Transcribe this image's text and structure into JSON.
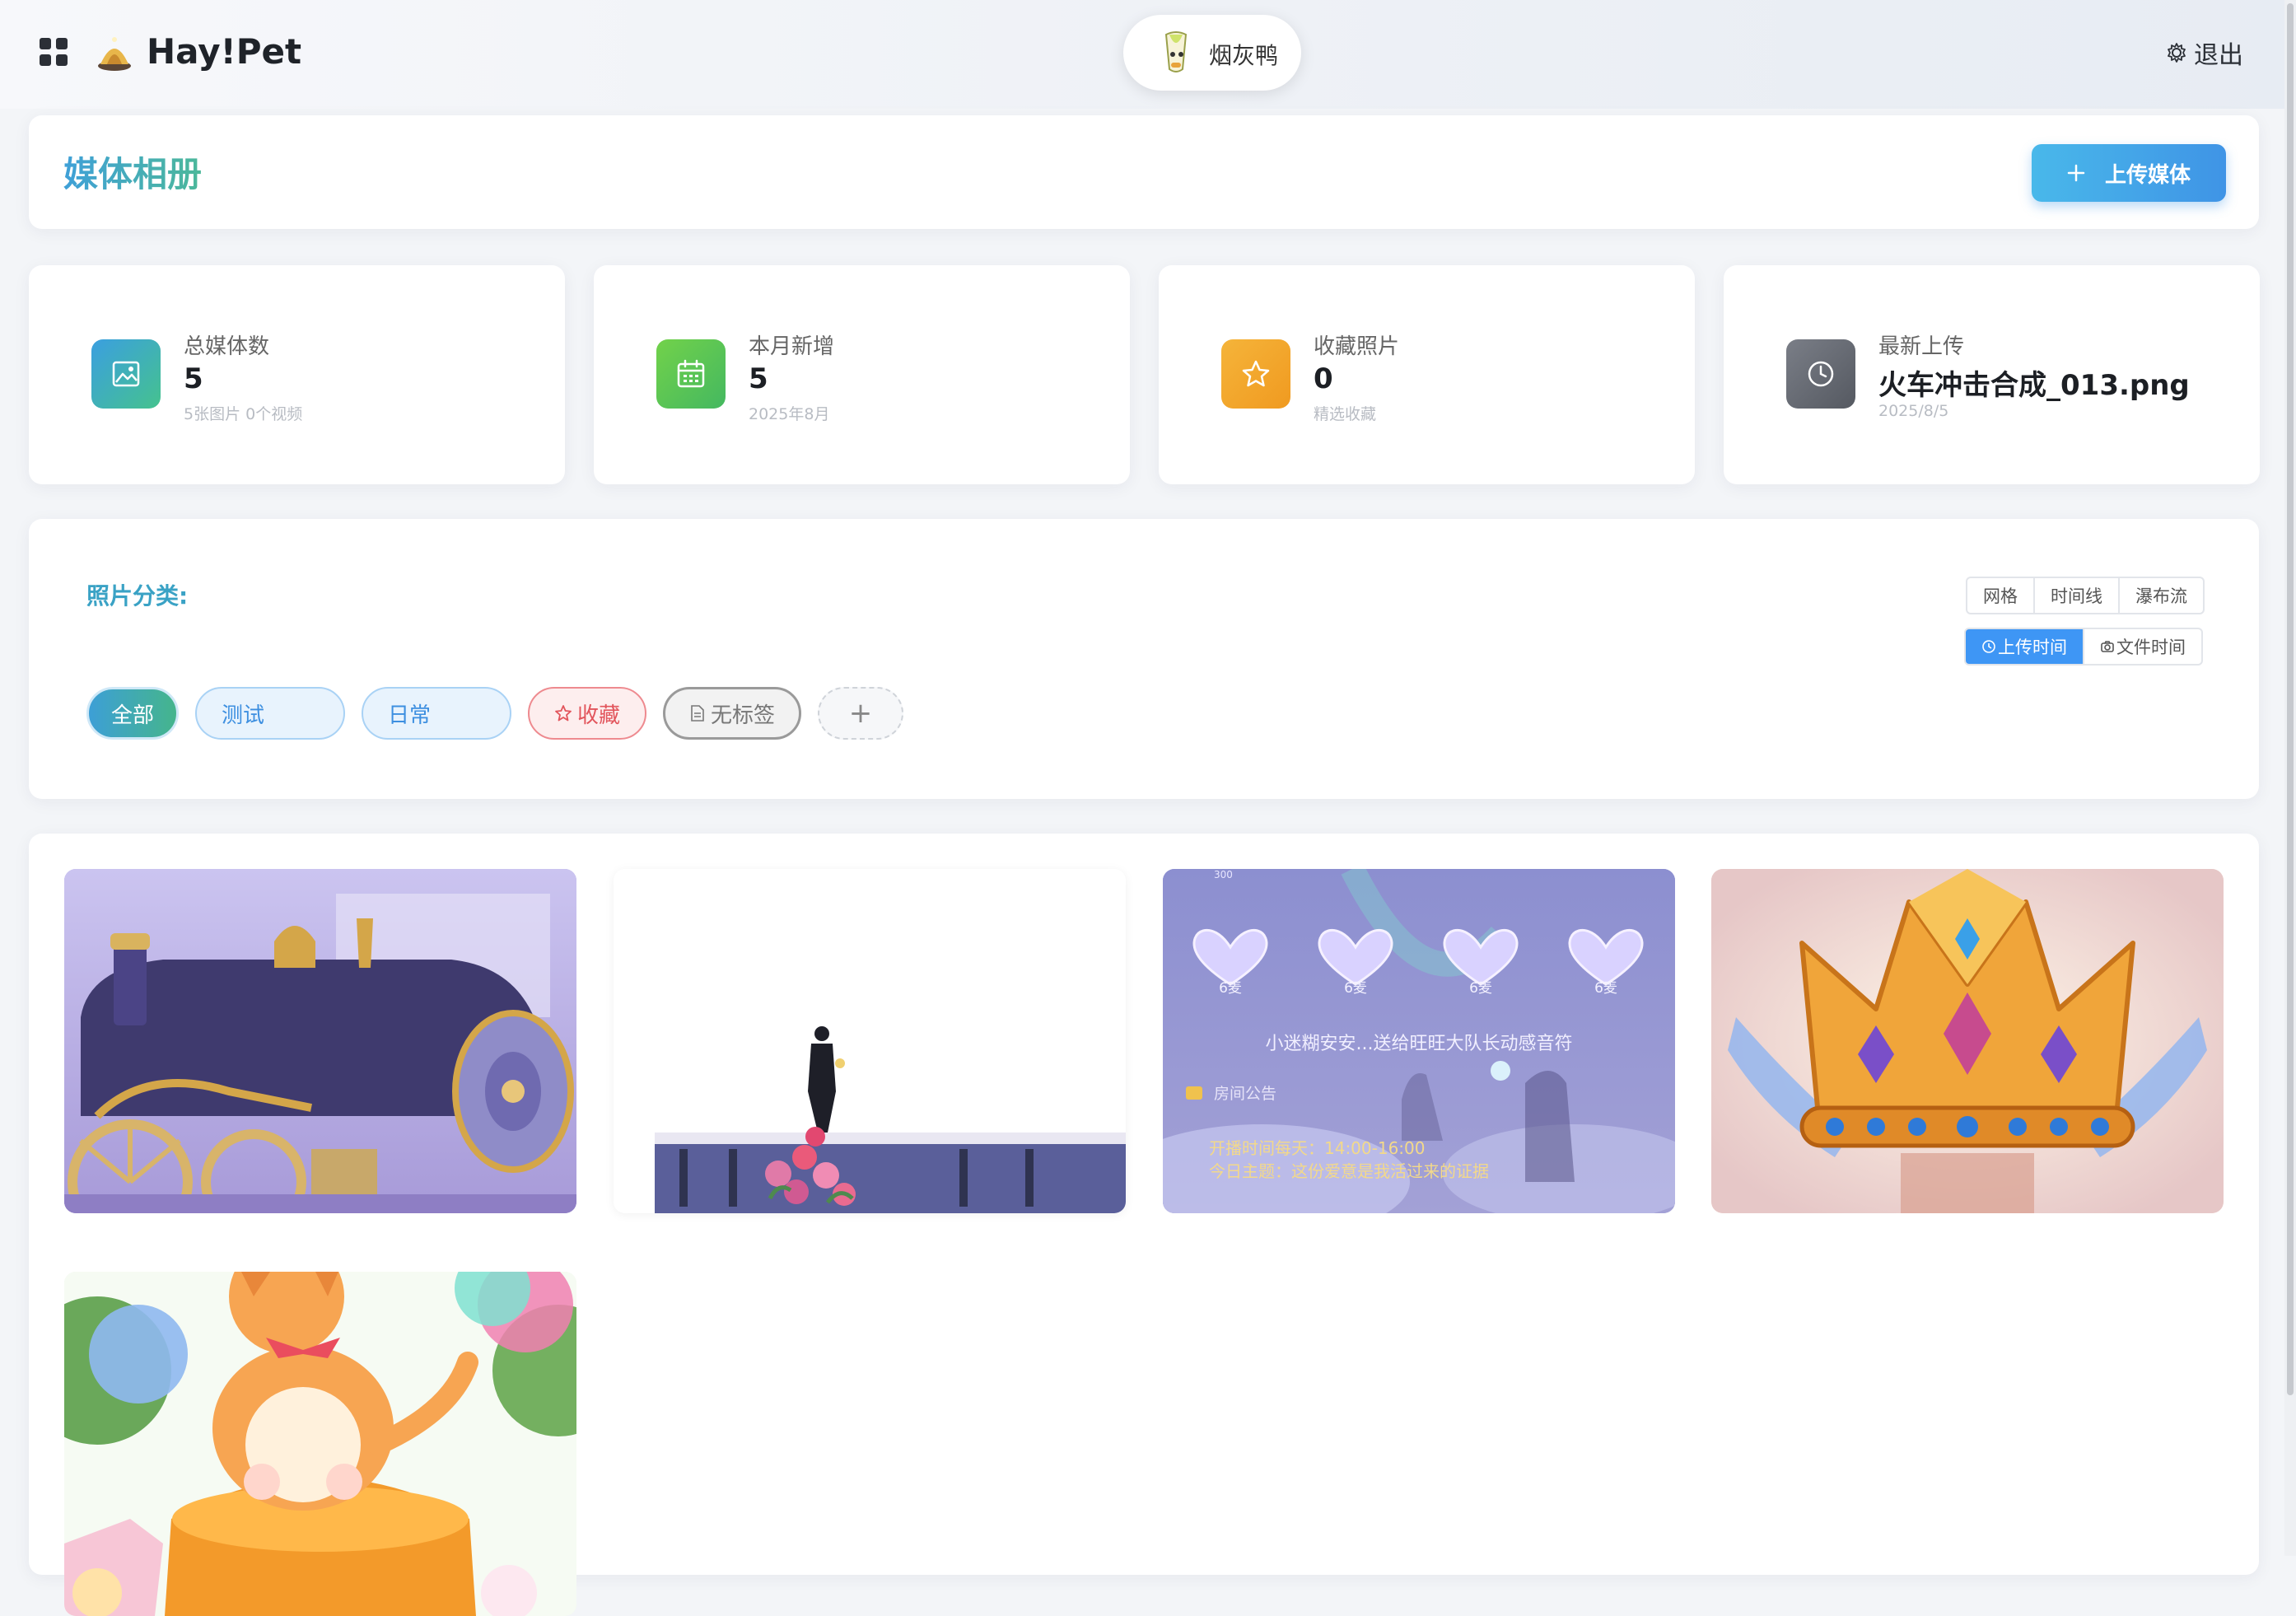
{
  "header": {
    "brand": "Hay!Pet",
    "user_name": "烟灰鸭",
    "logout_label": "退出"
  },
  "page": {
    "title": "媒体相册",
    "upload_button": "上传媒体"
  },
  "stats": [
    {
      "label": "总媒体数",
      "value": "5",
      "sub": "5张图片 0个视频",
      "icon": "image-icon",
      "color": "#3aa8c0"
    },
    {
      "label": "本月新增",
      "value": "5",
      "sub": "2025年8月",
      "icon": "calendar-icon",
      "color": "#5cc45a"
    },
    {
      "label": "收藏照片",
      "value": "0",
      "sub": "精选收藏",
      "icon": "star-icon",
      "color": "#f0a92a"
    },
    {
      "label": "最新上传",
      "value": "火车冲击合成_013.png",
      "sub": "2025/8/5",
      "icon": "clock-icon",
      "color": "#6b6f78"
    }
  ],
  "filters": {
    "label": "照片分类:",
    "view_modes": [
      "网格",
      "时间线",
      "瀑布流"
    ],
    "sort_modes": [
      "上传时间",
      "文件时间"
    ],
    "active_sort": "上传时间",
    "categories": [
      "全部",
      "测试",
      "日常",
      "收藏",
      "无标签"
    ],
    "add_label": "+"
  },
  "gallery": {
    "items": [
      {
        "name": "train-image",
        "texts": []
      },
      {
        "name": "groom-image",
        "texts": []
      },
      {
        "name": "stream-room-image",
        "texts": {
          "coins": "300",
          "mic_labels": [
            "6麦",
            "6麦",
            "6麦",
            "6麦"
          ],
          "banner": "小迷糊安安...送给旺旺大队长动感音符",
          "notice_title": "房间公告",
          "line1": "开播时间每天：14:00-16:00",
          "line2": "今日主题：这份爱意是我活过来的证据"
        }
      },
      {
        "name": "crown-image",
        "texts": []
      },
      {
        "name": "cat-image",
        "texts": []
      }
    ]
  },
  "colors": {
    "accent": "#3e96f5",
    "title_gradient_start": "#3fa0d8",
    "title_gradient_end": "#4cb89a"
  }
}
